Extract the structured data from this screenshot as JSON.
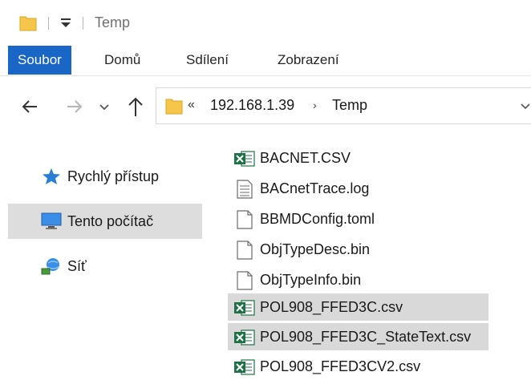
{
  "window": {
    "title": "Temp"
  },
  "ribbon": {
    "tabs": [
      {
        "label": "Soubor",
        "active": true
      },
      {
        "label": "Domů",
        "active": false
      },
      {
        "label": "Sdílení",
        "active": false
      },
      {
        "label": "Zobrazení",
        "active": false
      }
    ]
  },
  "address": {
    "overflow": "«",
    "crumbs": [
      "192.168.1.39",
      "Temp"
    ],
    "separator": "›"
  },
  "sidebar": {
    "items": [
      {
        "label": "Rychlý přístup",
        "icon": "star-icon",
        "selected": false
      },
      {
        "label": "Tento počítač",
        "icon": "monitor-icon",
        "selected": true
      },
      {
        "label": "Síť",
        "icon": "network-icon",
        "selected": false
      }
    ]
  },
  "files": [
    {
      "name": "BACNET.CSV",
      "icon": "excel-icon",
      "selected": false
    },
    {
      "name": "BACnetTrace.log",
      "icon": "text-file-icon",
      "selected": false
    },
    {
      "name": "BBMDConfig.toml",
      "icon": "file-icon",
      "selected": false
    },
    {
      "name": "ObjTypeDesc.bin",
      "icon": "file-icon",
      "selected": false
    },
    {
      "name": "ObjTypeInfo.bin",
      "icon": "file-icon",
      "selected": false
    },
    {
      "name": "POL908_FFED3C.csv",
      "icon": "excel-icon",
      "selected": true
    },
    {
      "name": "POL908_FFED3C_StateText.csv",
      "icon": "excel-icon",
      "selected": true
    },
    {
      "name": "POL908_FFED3CV2.csv",
      "icon": "excel-icon",
      "selected": false
    }
  ],
  "colors": {
    "accent": "#1a66c6",
    "folder": "#f5c64a",
    "excel": "#1e7145",
    "selection": "#d9d9d9"
  }
}
